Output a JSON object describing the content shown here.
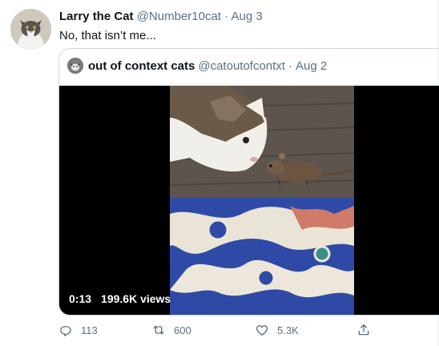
{
  "tweet": {
    "author_name": "Larry the Cat",
    "author_handle": "@Number10cat",
    "separator": "·",
    "date": "Aug 3",
    "text": "No, that isn’t me...",
    "avatar_icon": "cat-avatar"
  },
  "quoted": {
    "author_name": "out of context cats",
    "author_handle": "@catoutofcontxt",
    "separator": "·",
    "date": "Aug 2",
    "avatar_icon": "cat-avatar",
    "video": {
      "duration": "0:13",
      "views": "199.6K views"
    }
  },
  "actions": {
    "reply_count": "113",
    "retweet_count": "600",
    "like_count": "5.3K",
    "reply_icon": "reply-icon",
    "retweet_icon": "retweet-icon",
    "like_icon": "heart-icon",
    "share_icon": "share-icon",
    "icon_color": "#5b7083"
  }
}
